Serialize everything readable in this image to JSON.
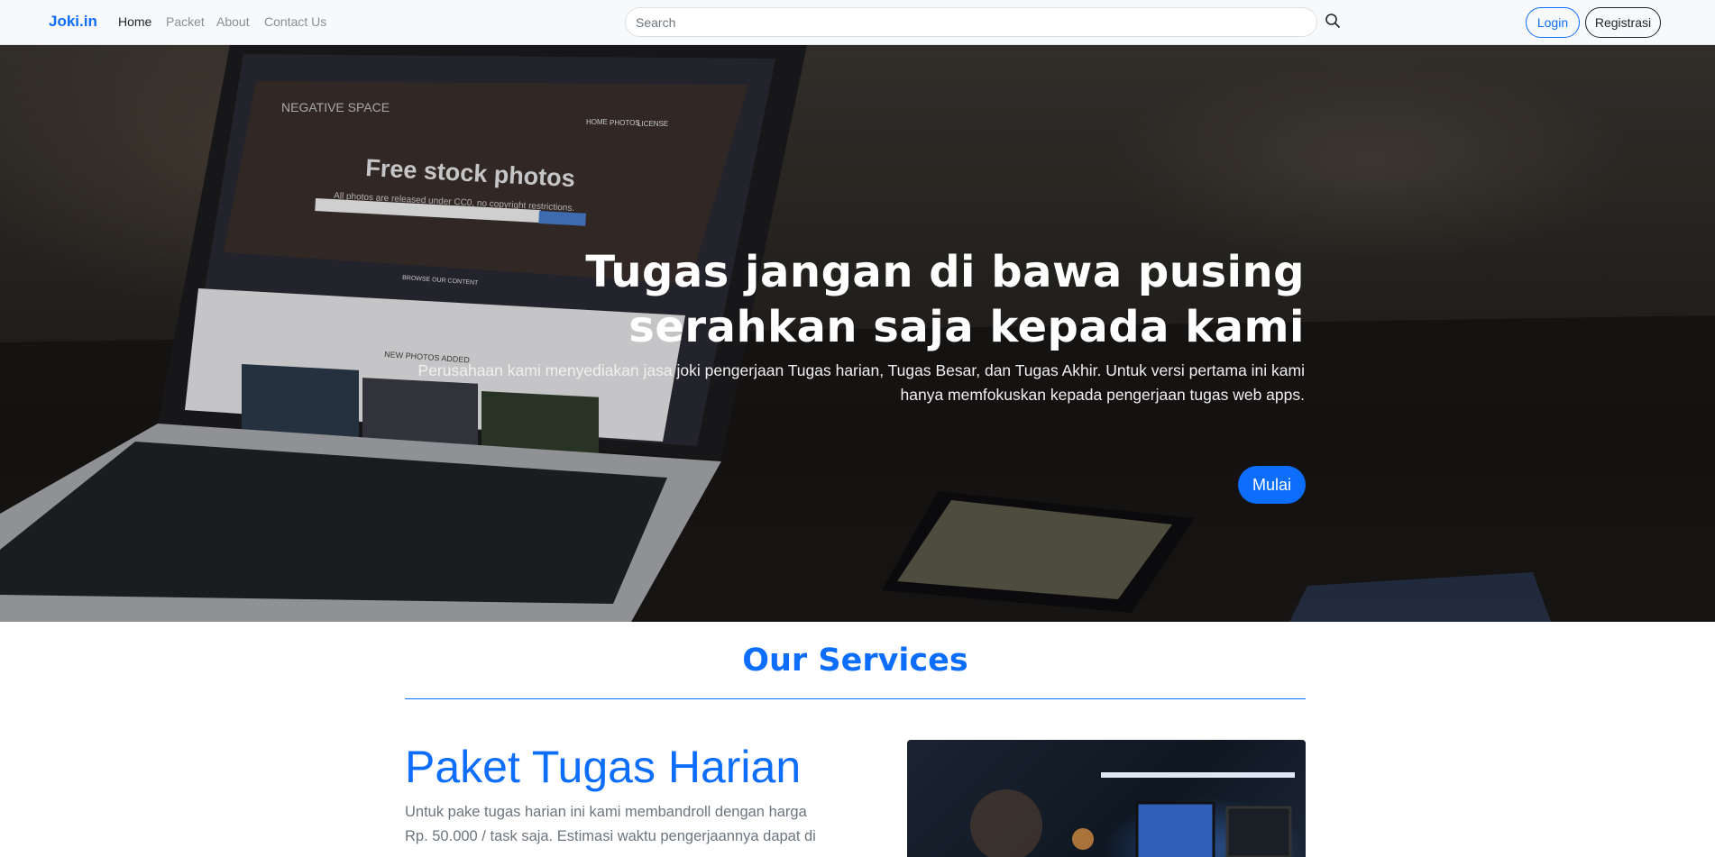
{
  "navbar": {
    "brand": "Joki.in",
    "links": [
      "Home",
      "Packet",
      "About",
      "Contact Us"
    ],
    "search_placeholder": "Search",
    "login_label": "Login",
    "register_label": "Registrasi"
  },
  "hero": {
    "title": "Tugas jangan di bawa pusing serahkan saja kepada kami",
    "subtitle": "Perusahaan kami menyediakan jasa joki pengerjaan Tugas harian, Tugas Besar, dan Tugas Akhir. Untuk versi pertama ini kami hanya memfokuskan kepada pengerjaan tugas web apps.",
    "cta_label": "Mulai",
    "laptop_screen": {
      "site_name": "NEGATIVE SPACE",
      "nav": [
        "HOME",
        "PHOTOS",
        "LICENSE"
      ],
      "headline": "Free stock photos",
      "tagline": "All photos are released under CC0, no copyright restrictions.",
      "button_label": "BROWSE OUR CONTENT",
      "section_label": "NEW PHOTOS ADDED"
    }
  },
  "services": {
    "title": "Our Services",
    "item": {
      "title": "Paket Tugas Harian",
      "description": "Untuk pake tugas harian ini kami membandroll dengan harga Rp. 50.000 / task saja. Estimasi waktu pengerjaannya dapat di"
    }
  },
  "colors": {
    "accent": "#0d6efd",
    "navbar_bg": "#f8f9fa",
    "muted_text": "#6c757d"
  }
}
